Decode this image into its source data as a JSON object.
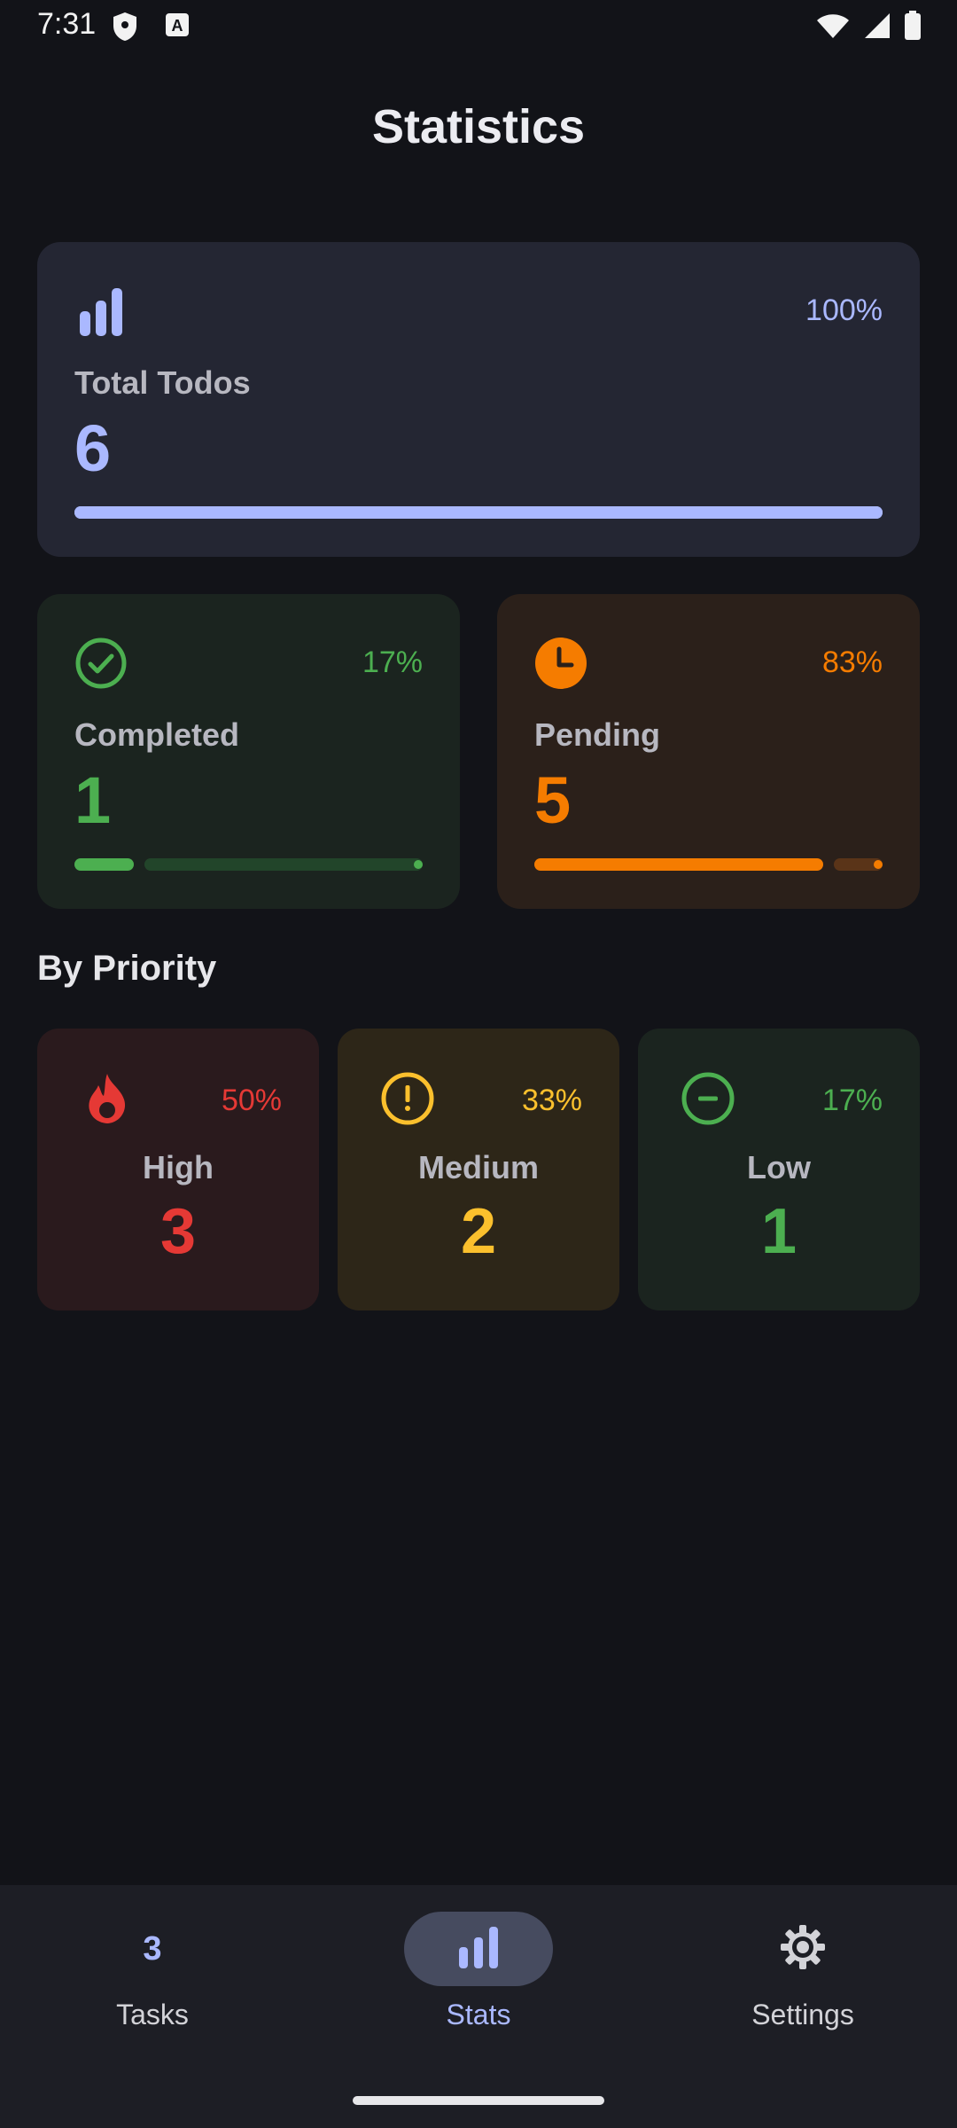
{
  "status_bar": {
    "time": "7:31"
  },
  "header": {
    "title": "Statistics"
  },
  "colors": {
    "accent": "#aab8ff",
    "green": "#4caf50",
    "orange": "#f57c00",
    "red": "#e53935",
    "yellow": "#fbc02d"
  },
  "total_card": {
    "label": "Total Todos",
    "value": "6",
    "percent": "100%",
    "progress": 1.0,
    "icon": "bar-chart-icon"
  },
  "completed_card": {
    "label": "Completed",
    "value": "1",
    "percent": "17%",
    "progress": 0.17,
    "icon": "check-circle-icon"
  },
  "pending_card": {
    "label": "Pending",
    "value": "5",
    "percent": "83%",
    "progress": 0.83,
    "icon": "clock-icon"
  },
  "priority_section": {
    "title": "By Priority",
    "items": [
      {
        "label": "High",
        "value": "3",
        "percent": "50%",
        "icon": "fire-icon"
      },
      {
        "label": "Medium",
        "value": "2",
        "percent": "33%",
        "icon": "exclamation-circle-icon"
      },
      {
        "label": "Low",
        "value": "1",
        "percent": "17%",
        "icon": "minus-circle-icon"
      }
    ]
  },
  "bottom_nav": {
    "tasks": {
      "label": "Tasks",
      "count": "3"
    },
    "stats": {
      "label": "Stats",
      "icon": "bar-chart-icon",
      "selected": true
    },
    "settings": {
      "label": "Settings",
      "icon": "gear-icon"
    }
  }
}
